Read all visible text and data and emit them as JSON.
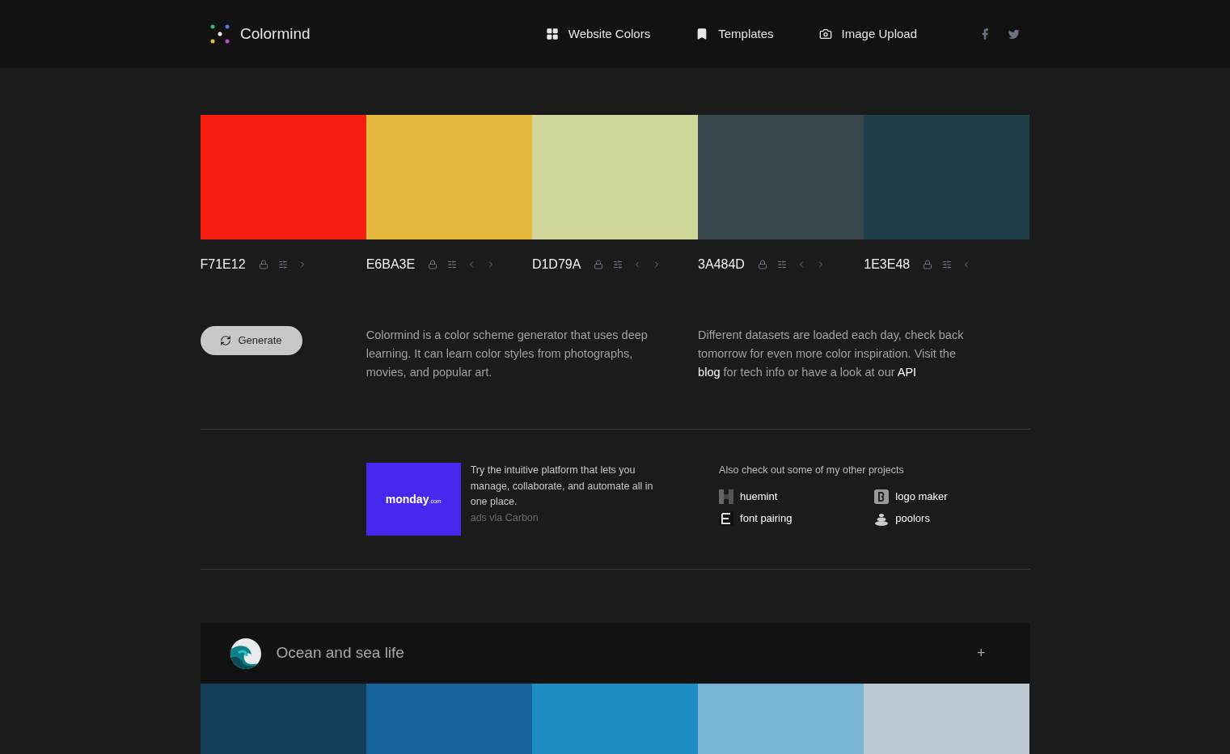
{
  "brand": {
    "name": "Colormind"
  },
  "nav": [
    {
      "label": "Website Colors",
      "kind": "grid"
    },
    {
      "label": "Templates",
      "kind": "bookmark"
    },
    {
      "label": "Image Upload",
      "kind": "camera"
    }
  ],
  "social": [
    {
      "kind": "facebook"
    },
    {
      "kind": "twitter"
    }
  ],
  "palette": [
    {
      "hex": "F71E12",
      "color": "#f71e12",
      "has_prev": false,
      "has_next": true
    },
    {
      "hex": "E6BA3E",
      "color": "#e6ba3e",
      "has_prev": true,
      "has_next": true
    },
    {
      "hex": "D1D79A",
      "color": "#d1d79a",
      "has_prev": true,
      "has_next": true
    },
    {
      "hex": "3A484D",
      "color": "#3a484d",
      "has_prev": true,
      "has_next": true
    },
    {
      "hex": "1E3E48",
      "color": "#1e3e48",
      "has_prev": true,
      "has_next": false
    }
  ],
  "generate_button": "Generate",
  "intro": "Colormind is a color scheme generator that uses deep learning. It can learn color styles from photographs, movies, and popular art.",
  "datasets": {
    "text": "Different datasets are loaded each day, check back tomorrow for even more color inspiration. Visit the",
    "link_1": "blog",
    "middle": "for tech info or have a look at our",
    "link_2": "API"
  },
  "ad": {
    "logo": "monday",
    "logo_suffix": ".com",
    "text": "Try the intuitive platform that lets you manage, collaborate, and automate all in one place.",
    "credit": "ads via Carbon"
  },
  "projects": {
    "heading": "Also check out some of my other projects",
    "items": [
      {
        "label": "huemint",
        "kind": "huemint"
      },
      {
        "label": "logo maker",
        "kind": "logo"
      },
      {
        "label": "font pairing",
        "kind": "font"
      },
      {
        "label": "poolors",
        "kind": "poolors"
      }
    ]
  },
  "collection": {
    "title": "Ocean and sea life",
    "expand": "+",
    "swatches": [
      {
        "color": "#133d59"
      },
      {
        "color": "#16649b"
      },
      {
        "color": "#1e8dc4"
      },
      {
        "color": "#78b5d5"
      },
      {
        "color": "#bac8d2"
      }
    ]
  }
}
